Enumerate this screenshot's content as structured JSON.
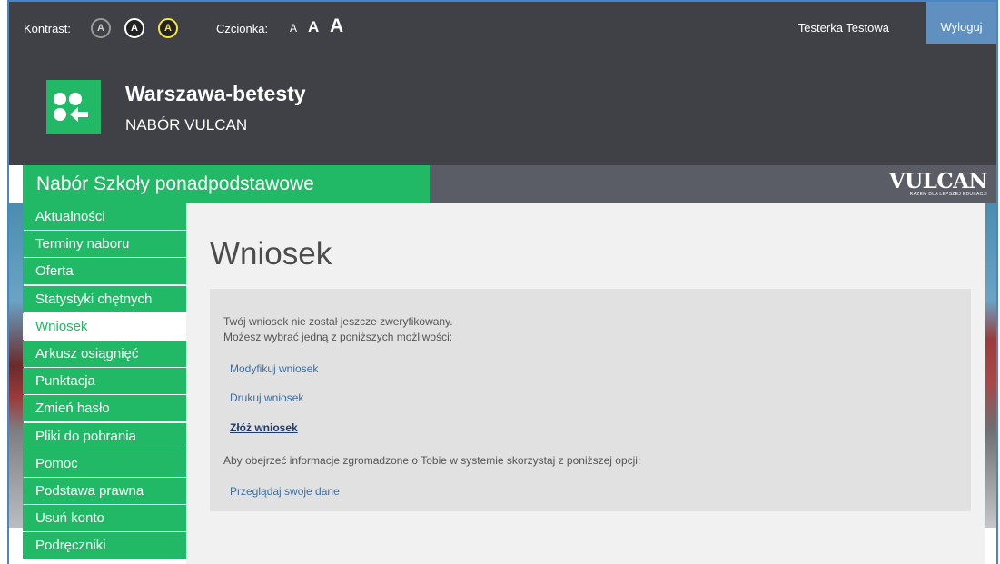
{
  "header": {
    "contrast_label": "Kontrast:",
    "contrast_options": [
      "A",
      "A",
      "A"
    ],
    "font_label": "Czcionka:",
    "font_sizes": [
      "A",
      "A",
      "A"
    ],
    "user_name": "Testerka Testowa",
    "logout_label": "Wyloguj",
    "site_title": "Warszawa-betesty",
    "site_subtitle": "NABÓR VULCAN"
  },
  "banner": {
    "title": "Nabór Szkoły ponadpodstawowe",
    "vulcan_logo": "VULCAN",
    "vulcan_tagline": "RAZEM DLA LEPSZEJ EDUKACJI"
  },
  "sidebar": {
    "active": "Wniosek",
    "items": [
      {
        "label": "Aktualności"
      },
      {
        "label": "Terminy naboru"
      },
      {
        "label": "Oferta"
      },
      {
        "label": "Statystyki chętnych"
      },
      {
        "label": "Wniosek"
      },
      {
        "label": "Arkusz osiągnięć"
      },
      {
        "label": "Punktacja"
      },
      {
        "label": "Zmień hasło"
      },
      {
        "label": "Pliki do pobrania"
      },
      {
        "label": "Pomoc"
      },
      {
        "label": "Podstawa prawna"
      },
      {
        "label": "Usuń konto"
      },
      {
        "label": "Podręczniki"
      }
    ]
  },
  "main": {
    "title": "Wniosek",
    "status_text": "Twój wniosek nie został jeszcze zweryfikowany.",
    "options_text": "Możesz wybrać jedną z poniższych możliwości:",
    "links": {
      "modify": "Modyfikuj wniosek",
      "print": "Drukuj wniosek",
      "submit": "Złóż wniosek",
      "browse": "Przeglądaj swoje dane"
    },
    "info_text": "Aby obejrzeć informacje zgromadzone o Tobie w systemie skorzystaj z poniższej opcji:"
  },
  "colors": {
    "brand_green": "#21b866",
    "header_dark": "#3f4146",
    "logout_blue": "#5f90bf",
    "link_blue": "#3c6e9e"
  }
}
